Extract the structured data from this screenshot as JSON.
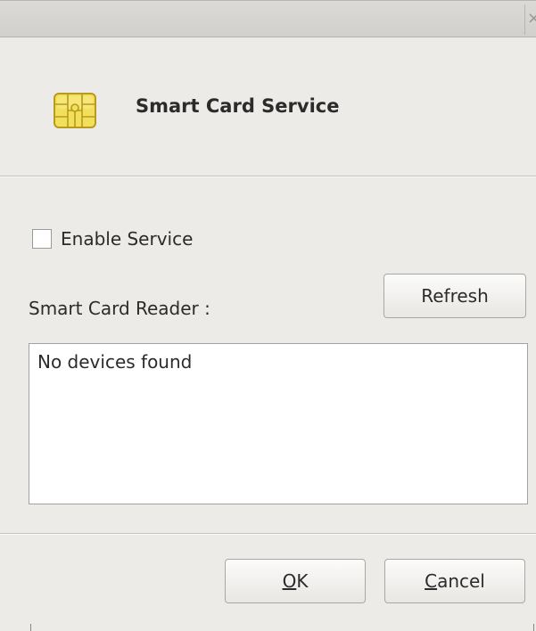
{
  "window": {
    "close_glyph": "×"
  },
  "header": {
    "title": "Smart Card Service",
    "icon": "smart-card-chip-icon"
  },
  "service": {
    "enable_label": "Enable Service",
    "enabled": false
  },
  "reader": {
    "label": "Smart Card Reader :",
    "refresh_label": "Refresh",
    "devices": [
      "No devices found"
    ]
  },
  "footer": {
    "ok_mnemonic": "O",
    "ok_rest": "K",
    "cancel_mnemonic": "C",
    "cancel_rest": "ancel"
  },
  "colors": {
    "background": "#edebe8",
    "chip_gold": "#f2df5a",
    "chip_outline": "#b79a1e"
  }
}
